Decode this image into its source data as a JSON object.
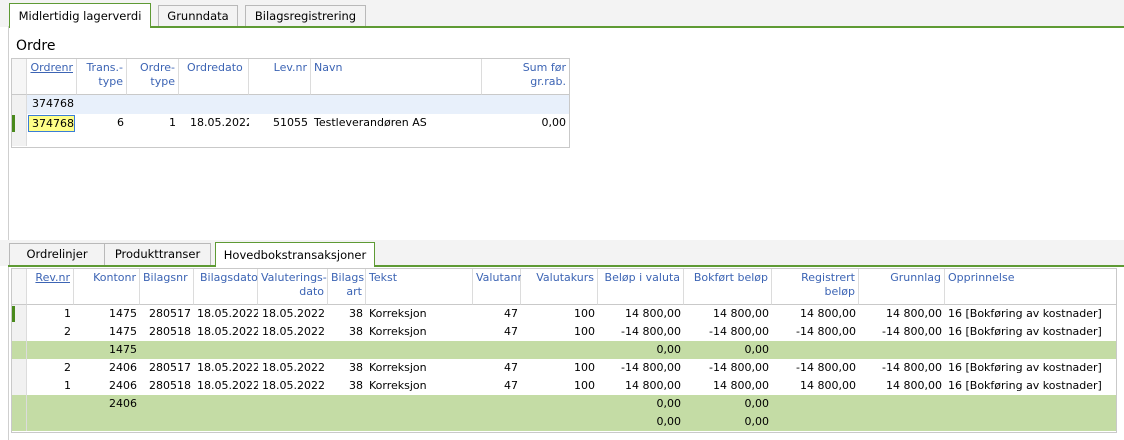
{
  "top_tabs": [
    {
      "label": "Midlertidig lagerverdi",
      "active": true
    },
    {
      "label": "Grunndata",
      "active": false
    },
    {
      "label": "Bilagsregistrering",
      "active": false
    }
  ],
  "ordre": {
    "title": "Ordre",
    "headers": {
      "ordrenr": "Ordrenr",
      "trans_type_1": "Trans.-",
      "trans_type_2": "type",
      "ordre_type_1": "Ordre-",
      "ordre_type_2": "type",
      "ordredato": "Ordredato",
      "levnr": "Lev.nr",
      "navn": "Navn",
      "sum_1": "Sum før",
      "sum_2": "gr.rab."
    },
    "filter_row": {
      "ordrenr": "374768"
    },
    "rows": [
      {
        "ordrenr": "374768",
        "trans_type": "6",
        "ordre_type": "1",
        "ordredato": "18.05.2022",
        "levnr": "51055",
        "navn": "Testleverandøren AS",
        "sum": "0,00"
      }
    ]
  },
  "bottom_tabs": [
    {
      "label": "Ordrelinjer",
      "active": false
    },
    {
      "label": "Produkttranser",
      "active": false
    },
    {
      "label": "Hovedbokstransaksjoner",
      "active": true
    }
  ],
  "trans": {
    "headers": {
      "revnr": "Rev.nr",
      "kontonr": "Kontonr",
      "bilagsnr": "Bilagsnr",
      "bilagsdato": "Bilagsdato",
      "valuteringsdato_1": "Valuterings-",
      "valuteringsdato_2": "dato",
      "bilagsart_1": "Bilags",
      "bilagsart_2": "art",
      "tekst": "Tekst",
      "valutanr": "Valutanr",
      "valutakurs": "Valutakurs",
      "belop_valuta": "Beløp i valuta",
      "bokfort": "Bokført beløp",
      "registrert_1": "Registrert",
      "registrert_2": "beløp",
      "grunnlag": "Grunnlag",
      "opprinnelse": "Opprinnelse"
    },
    "rows": [
      {
        "type": "data",
        "current": true,
        "revnr": "1",
        "kontonr": "1475",
        "bilagsnr": "280517",
        "bilagsdato": "18.05.2022",
        "valuteringsdato": "18.05.2022",
        "bilagsart": "38",
        "tekst": "Korreksjon",
        "valutanr": "47",
        "valutakurs": "100",
        "belop_valuta": "14 800,00",
        "bokfort": "14 800,00",
        "registrert": "14 800,00",
        "grunnlag": "14 800,00",
        "opprinnelse": "16 [Bokføring av kostnader]"
      },
      {
        "type": "data",
        "current": false,
        "revnr": "2",
        "kontonr": "1475",
        "bilagsnr": "280518",
        "bilagsdato": "18.05.2022",
        "valuteringsdato": "18.05.2022",
        "bilagsart": "38",
        "tekst": "Korreksjon",
        "valutanr": "47",
        "valutakurs": "100",
        "belop_valuta": "-14 800,00",
        "bokfort": "-14 800,00",
        "registrert": "-14 800,00",
        "grunnlag": "-14 800,00",
        "opprinnelse": "16 [Bokføring av kostnader]"
      },
      {
        "type": "sum",
        "kontonr": "1475",
        "belop_valuta": "0,00",
        "bokfort": "0,00"
      },
      {
        "type": "data",
        "current": false,
        "revnr": "2",
        "kontonr": "2406",
        "bilagsnr": "280517",
        "bilagsdato": "18.05.2022",
        "valuteringsdato": "18.05.2022",
        "bilagsart": "38",
        "tekst": "Korreksjon",
        "valutanr": "47",
        "valutakurs": "100",
        "belop_valuta": "-14 800,00",
        "bokfort": "-14 800,00",
        "registrert": "-14 800,00",
        "grunnlag": "-14 800,00",
        "opprinnelse": "16 [Bokføring av kostnader]"
      },
      {
        "type": "data",
        "current": false,
        "revnr": "1",
        "kontonr": "2406",
        "bilagsnr": "280518",
        "bilagsdato": "18.05.2022",
        "valuteringsdato": "18.05.2022",
        "bilagsart": "38",
        "tekst": "Korreksjon",
        "valutanr": "47",
        "valutakurs": "100",
        "belop_valuta": "14 800,00",
        "bokfort": "14 800,00",
        "registrert": "14 800,00",
        "grunnlag": "14 800,00",
        "opprinnelse": "16 [Bokføring av kostnader]"
      },
      {
        "type": "sum",
        "kontonr": "2406",
        "belop_valuta": "0,00",
        "bokfort": "0,00"
      },
      {
        "type": "sum",
        "kontonr": "",
        "belop_valuta": "0,00",
        "bokfort": "0,00"
      }
    ]
  },
  "colors": {
    "accent": "#5e9a34",
    "sum_row": "#c4dca5",
    "link": "#3c64b4",
    "filter_row": "#e8f0fb",
    "selected_cell": "#ffff88"
  }
}
